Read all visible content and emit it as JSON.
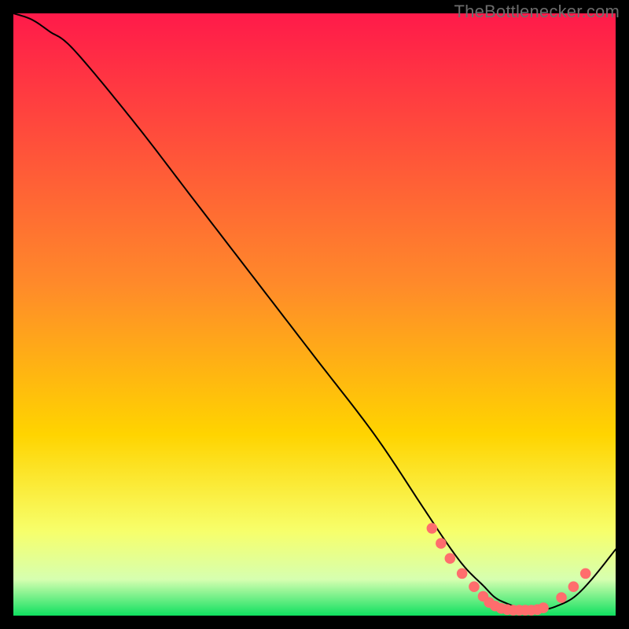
{
  "watermark": "TheBottlenecker.com",
  "chart_data": {
    "type": "line",
    "title": "",
    "xlabel": "",
    "ylabel": "",
    "xlim": [
      0,
      100
    ],
    "ylim": [
      0,
      100
    ],
    "grid": false,
    "legend": false,
    "background_gradient": {
      "top": "#ff1a4a",
      "mid": "#ffd400",
      "low": "#f7ff6b",
      "bottom": "#10e060"
    },
    "series": [
      {
        "name": "curve",
        "stroke": "#000000",
        "stroke_width": 2,
        "x": [
          0,
          3,
          6,
          10,
          20,
          30,
          40,
          50,
          60,
          68,
          72,
          75,
          78,
          80,
          82,
          84,
          86,
          88,
          90,
          93,
          96,
          100
        ],
        "y": [
          100,
          99,
          97,
          94,
          82,
          69,
          56,
          43,
          30,
          18,
          12,
          8,
          5,
          3,
          2,
          1.3,
          1,
          1,
          1.5,
          3,
          6,
          11
        ]
      }
    ],
    "markers": {
      "name": "dots",
      "color": "#ff6d6d",
      "radius": 6.8,
      "points": [
        {
          "x": 69.5,
          "y": 14.5
        },
        {
          "x": 71.0,
          "y": 12.0
        },
        {
          "x": 72.5,
          "y": 9.5
        },
        {
          "x": 74.5,
          "y": 7.0
        },
        {
          "x": 76.5,
          "y": 4.8
        },
        {
          "x": 78.0,
          "y": 3.2
        },
        {
          "x": 79.0,
          "y": 2.2
        },
        {
          "x": 80.0,
          "y": 1.6
        },
        {
          "x": 81.0,
          "y": 1.2
        },
        {
          "x": 82.0,
          "y": 1.0
        },
        {
          "x": 83.0,
          "y": 0.9
        },
        {
          "x": 84.0,
          "y": 0.9
        },
        {
          "x": 85.0,
          "y": 0.9
        },
        {
          "x": 86.0,
          "y": 0.9
        },
        {
          "x": 87.0,
          "y": 1.0
        },
        {
          "x": 88.0,
          "y": 1.3
        },
        {
          "x": 91.0,
          "y": 3.0
        },
        {
          "x": 93.0,
          "y": 4.8
        },
        {
          "x": 95.0,
          "y": 7.0
        }
      ]
    }
  }
}
